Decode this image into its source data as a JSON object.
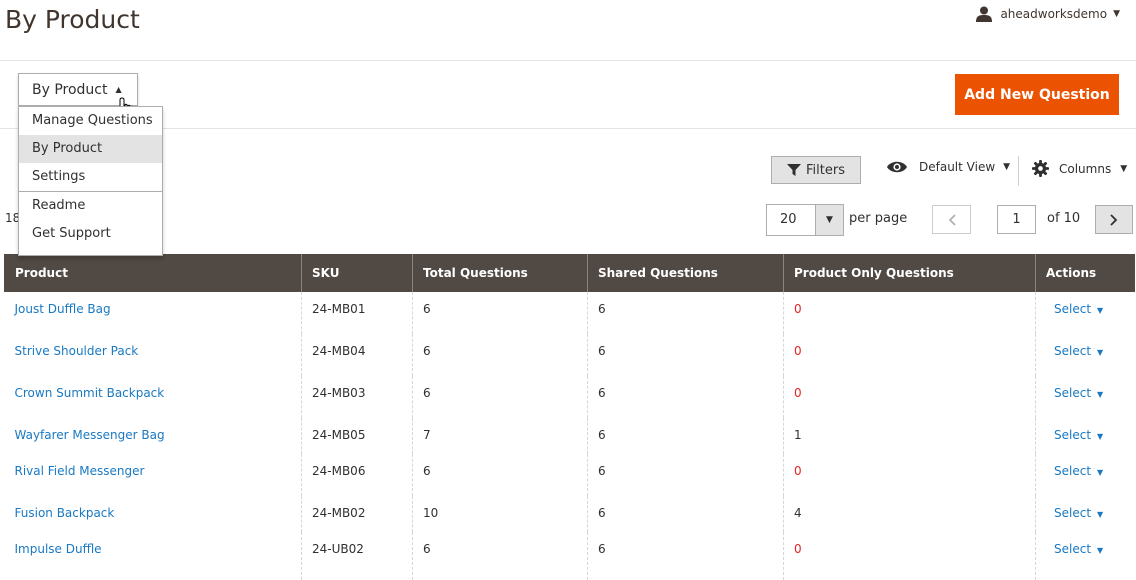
{
  "page": {
    "title": "By Product"
  },
  "user": {
    "name": "aheadworksdemo"
  },
  "switcher": {
    "label": "By Product",
    "menu": [
      "Manage Questions",
      "By Product",
      "Settings",
      "Readme",
      "Get Support"
    ],
    "active_index": 1
  },
  "toolbar": {
    "add_button": "Add New Question",
    "filters": "Filters",
    "view": "Default View",
    "columns": "Columns"
  },
  "pager": {
    "records_prefix": "18",
    "per_page_value": "20",
    "per_page_label": "per page",
    "current_page": "1",
    "of_label": "of 10"
  },
  "grid": {
    "headers": [
      "Product",
      "SKU",
      "Total Questions",
      "Shared Questions",
      "Product Only Questions",
      "Actions"
    ],
    "rows": [
      {
        "product": "Joust Duffle Bag",
        "sku": "24-MB01",
        "total": "6",
        "shared": "6",
        "only": "0",
        "action": "Select"
      },
      {
        "product": "Strive Shoulder Pack",
        "sku": "24-MB04",
        "total": "6",
        "shared": "6",
        "only": "0",
        "action": "Select"
      },
      {
        "product": "Crown Summit Backpack",
        "sku": "24-MB03",
        "total": "6",
        "shared": "6",
        "only": "0",
        "action": "Select"
      },
      {
        "product": "Wayfarer Messenger Bag",
        "sku": "24-MB05",
        "total": "7",
        "shared": "6",
        "only": "1",
        "action": "Select"
      },
      {
        "product": "Rival Field Messenger",
        "sku": "24-MB06",
        "total": "6",
        "shared": "6",
        "only": "0",
        "action": "Select"
      },
      {
        "product": "Fusion Backpack",
        "sku": "24-MB02",
        "total": "10",
        "shared": "6",
        "only": "4",
        "action": "Select"
      },
      {
        "product": "Impulse Duffle",
        "sku": "24-UB02",
        "total": "6",
        "shared": "6",
        "only": "0",
        "action": "Select"
      }
    ]
  },
  "colors": {
    "accent": "#eb5202",
    "header_bg": "#514943",
    "link": "#1979c3",
    "zero": "#e22626"
  },
  "icons": [
    "user-icon",
    "hand-cursor-icon",
    "filter-icon",
    "eye-icon",
    "gear-icon",
    "chevron-left-icon",
    "chevron-right-icon"
  ]
}
